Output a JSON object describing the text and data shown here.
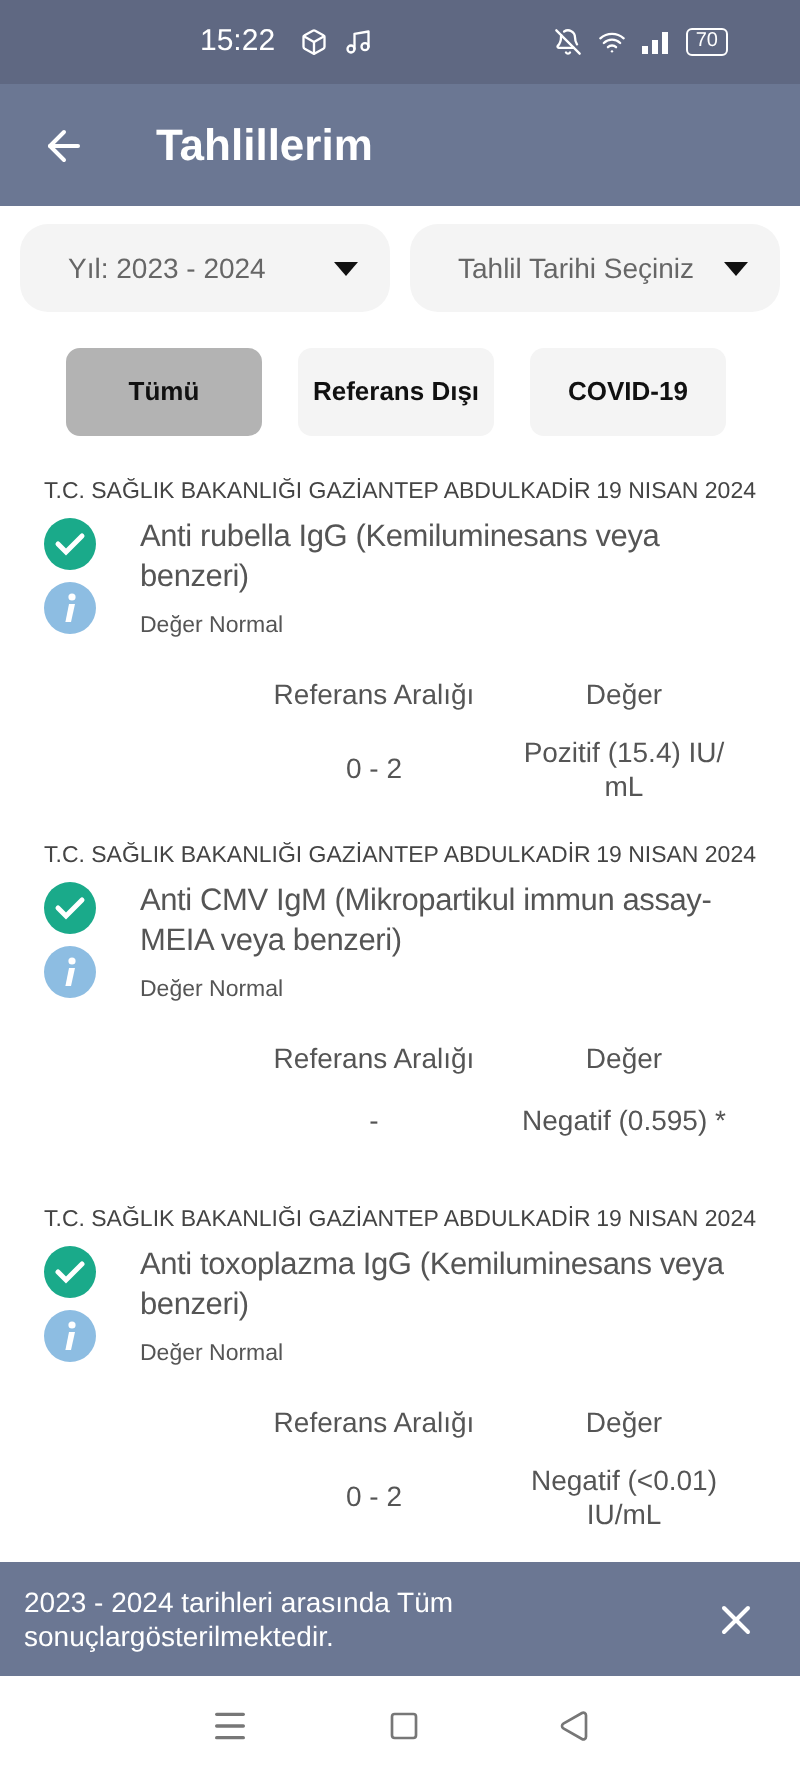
{
  "status_bar": {
    "time": "15:22",
    "battery": "70"
  },
  "header": {
    "title": "Tahlillerim"
  },
  "dropdowns": [
    {
      "label": "Yıl: 2023 - 2024"
    },
    {
      "label": "Tahlil Tarihi Seçiniz"
    }
  ],
  "filters": [
    {
      "label": "Tümü",
      "selected": true
    },
    {
      "label": "Referans Dışı",
      "selected": false
    },
    {
      "label": "COVID-19",
      "selected": false
    }
  ],
  "results": [
    {
      "institution": "T.C. SAĞLIK BAKANLIĞI GAZİANTEP ABDULKADİR",
      "date": "19 NISAN 2024",
      "test": "Anti rubella IgG (Kemiluminesans veya benzeri)",
      "status": "Değer Normal",
      "normal": true,
      "range_label": "Referans Aralığı",
      "value_label": "Değer",
      "range": "0 - 2",
      "value": "Pozitif (15.4) IU/ mL"
    },
    {
      "institution": "T.C. SAĞLIK BAKANLIĞI GAZİANTEP ABDULKADİR",
      "date": "19 NISAN 2024",
      "test": "Anti CMV IgM (Mikropartikul immun assay-MEIA veya benzeri)",
      "status": "Değer Normal",
      "normal": true,
      "range_label": "Referans Aralığı",
      "value_label": "Değer",
      "range": "-",
      "value": "Negatif (0.595) *"
    },
    {
      "institution": "T.C. SAĞLIK BAKANLIĞI GAZİANTEP ABDULKADİR",
      "date": "19 NISAN 2024",
      "test": "Anti toxoplazma IgG (Kemiluminesans veya benzeri)",
      "status": "Değer Normal",
      "normal": true,
      "range_label": "Referans Aralığı",
      "value_label": "Değer",
      "range": "0 - 2",
      "value": "Negatif (<0.01) IU/mL"
    }
  ],
  "snackbar": {
    "message": "2023 - 2024 tarihleri arasında Tüm sonuçlargösterilmektedir."
  }
}
